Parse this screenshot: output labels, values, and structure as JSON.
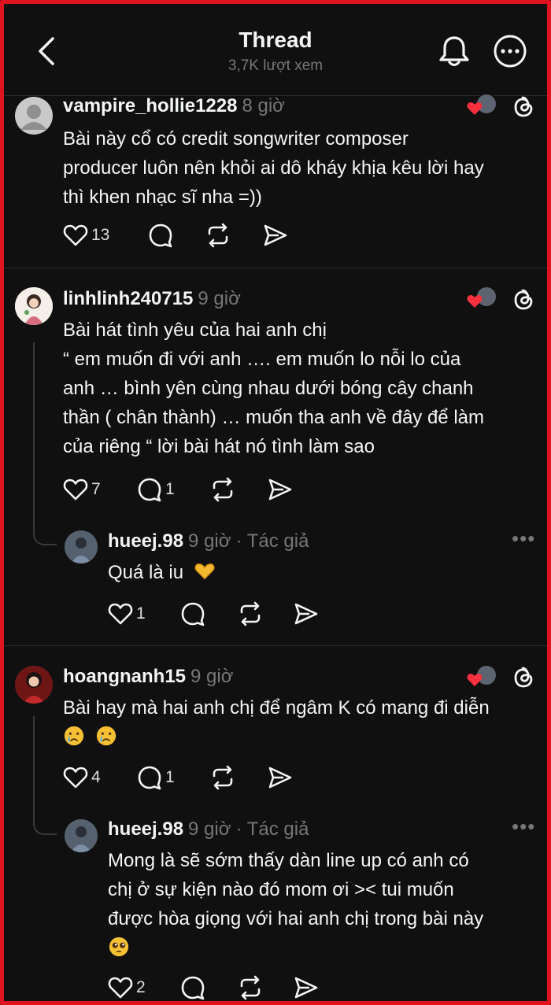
{
  "header": {
    "title": "Thread",
    "views": "3,7K lượt xem"
  },
  "posts": [
    {
      "username": "vampire_hollie1228",
      "time": "8 giờ",
      "lines": [
        "Bài này cổ có credit songwriter composer",
        "producer luôn nên khỏi ai dô kháy khịa kêu lời hay",
        "thì khen nhạc sĩ nha =))"
      ],
      "likes": "13"
    },
    {
      "username": "linhlinh240715",
      "time": "9 giờ",
      "lines": [
        "Bài hát tình yêu của hai anh chị",
        "“ em muốn đi với anh …. em muốn lo nỗi lo của",
        "anh … bình yên cùng nhau dưới bóng cây chanh",
        "thần ( chân thành) … muốn tha anh về đây để làm",
        "của riêng “ lời bài hát nó tình làm sao"
      ],
      "likes": "7",
      "replies": "1",
      "reply": {
        "username": "hueej.98",
        "time": "9 giờ",
        "author_tag": "· Tác giả",
        "text": "Quá là iu",
        "emoji": "heart-hands-emoji",
        "likes": "1"
      }
    },
    {
      "username": "hoangnanh15",
      "time": "9 giờ",
      "lines": [
        "Bài hay mà hai anh chị để ngâm K có mang đi diễn"
      ],
      "emoji_line": [
        "crying-face-emoji",
        "crying-face-emoji"
      ],
      "likes": "4",
      "replies": "1",
      "reply": {
        "username": "hueej.98",
        "time": "9 giờ",
        "author_tag": "· Tác giả",
        "lines": [
          "Mong là sẽ sớm thấy dàn line up có anh có",
          "chị ở sự kiện nào đó mom ơi >< tui muốn",
          "được hòa giọng với hai anh chị trong bài này"
        ],
        "emoji": "pleading-face-emoji",
        "likes": "2"
      }
    }
  ],
  "colors": {
    "background": "#101010",
    "text": "#f3f5f7",
    "muted": "#777777",
    "heart_badge": "#ff3040",
    "frame_border": "#e0141e"
  }
}
